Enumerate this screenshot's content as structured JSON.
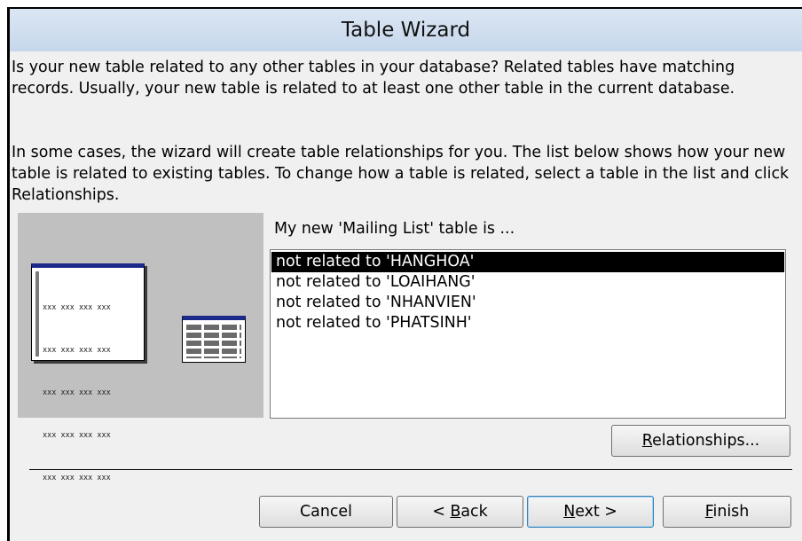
{
  "window": {
    "title": "Table Wizard"
  },
  "intro": {
    "paragraph1": "Is your new table related to any other tables in your database? Related tables have matching records. Usually, your new table is related to at least one other table in the current database.",
    "paragraph2": "In some cases, the wizard will create table relationships for you. The list below shows how your new table is related to existing tables. To change how a table is related, select a table in the list and click Relationships."
  },
  "illustration": {
    "rows": [
      "xxx xxx xxx xxx",
      "xxx xxx xxx xxx",
      "xxx xxx xxx xxx",
      "xxx xxx xxx xxx",
      "xxx xxx xxx xxx"
    ]
  },
  "list": {
    "label": "My new 'Mailing List' table is ...",
    "items": [
      "not related to 'HANGHOA'",
      "not related to 'LOAIHANG'",
      "not related to 'NHANVIEN'",
      "not related to 'PHATSINH'"
    ],
    "selected_index": 0
  },
  "buttons": {
    "relationships": {
      "before": "",
      "mnemonic": "R",
      "after": "elationships..."
    },
    "cancel": {
      "before": "Cancel",
      "mnemonic": "",
      "after": ""
    },
    "back": {
      "before": "< ",
      "mnemonic": "B",
      "after": "ack"
    },
    "next": {
      "before": "",
      "mnemonic": "N",
      "after": "ext >"
    },
    "finish": {
      "before": "",
      "mnemonic": "F",
      "after": "inish"
    }
  },
  "colors": {
    "title_bar": "#c6d7ec",
    "dialog_bg": "#f0f0f0",
    "selection": "#000000",
    "table_header": "#1b2a8a"
  }
}
